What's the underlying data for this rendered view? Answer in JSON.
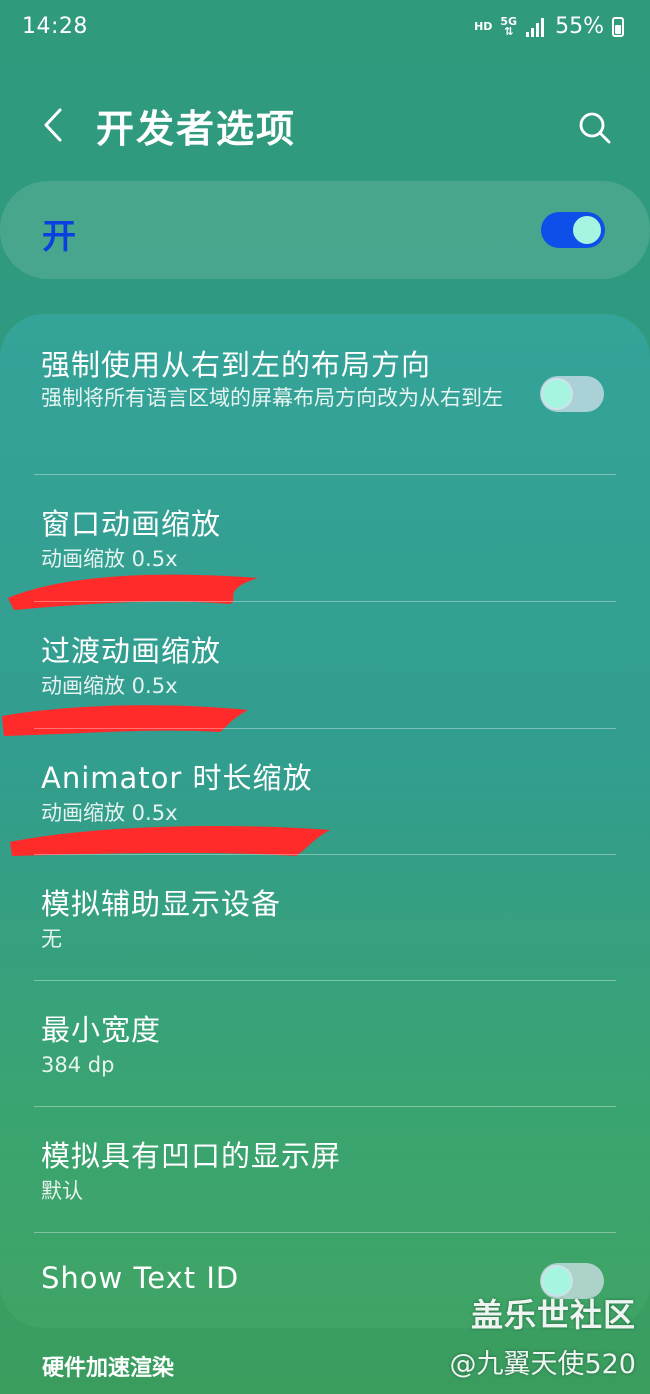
{
  "status_bar": {
    "time": "14:28",
    "hd": "HD",
    "network": "5G",
    "battery": "55%"
  },
  "header": {
    "title": "开发者选项"
  },
  "master_switch": {
    "label": "开",
    "state": "on"
  },
  "settings": [
    {
      "title": "强制使用从右到左的布局方向",
      "summary": "强制将所有语言区域的屏幕布局方向改为从右到左",
      "toggle": "off"
    },
    {
      "title": "窗口动画缩放",
      "summary": "动画缩放 0.5x"
    },
    {
      "title": "过渡动画缩放",
      "summary": "动画缩放 0.5x"
    },
    {
      "title": "Animator 时长缩放",
      "summary": "动画缩放 0.5x"
    },
    {
      "title": "模拟辅助显示设备",
      "summary": "无"
    },
    {
      "title": "最小宽度",
      "summary": "384 dp"
    },
    {
      "title": "模拟具有凹口的显示屏",
      "summary": "默认"
    },
    {
      "title": "Show Text ID",
      "toggle": "off"
    }
  ],
  "section_header": "硬件加速渲染",
  "watermark": {
    "line1": "盖乐世社区",
    "line2": "@九翼天使520"
  },
  "colors": {
    "accent_blue": "#0d4fe8",
    "annotation_red": "#ff2a2a"
  }
}
